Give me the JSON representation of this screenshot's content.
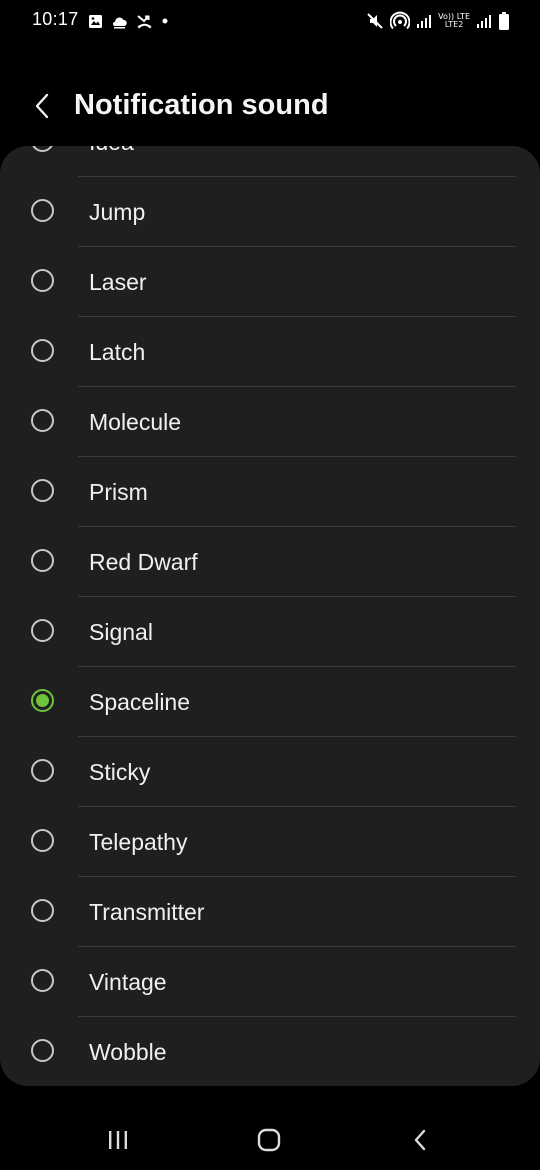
{
  "status_bar": {
    "time": "10:17",
    "network_top": "Vo)) LTE",
    "network_bottom": "LTE2"
  },
  "header": {
    "title": "Notification sound"
  },
  "sounds": [
    {
      "label": "Idea",
      "selected": false
    },
    {
      "label": "Jump",
      "selected": false
    },
    {
      "label": "Laser",
      "selected": false
    },
    {
      "label": "Latch",
      "selected": false
    },
    {
      "label": "Molecule",
      "selected": false
    },
    {
      "label": "Prism",
      "selected": false
    },
    {
      "label": "Red Dwarf",
      "selected": false
    },
    {
      "label": "Signal",
      "selected": false
    },
    {
      "label": "Spaceline",
      "selected": true
    },
    {
      "label": "Sticky",
      "selected": false
    },
    {
      "label": "Telepathy",
      "selected": false
    },
    {
      "label": "Transmitter",
      "selected": false
    },
    {
      "label": "Vintage",
      "selected": false
    },
    {
      "label": "Wobble",
      "selected": false
    }
  ],
  "colors": {
    "accent": "#6fc23b",
    "card_background": "#1f1f1f",
    "page_background": "#000000"
  },
  "icons": {
    "status_left": [
      "image-icon",
      "weather-icon",
      "missed-call-icon",
      "dot-icon"
    ],
    "status_right": [
      "mute-icon",
      "hotspot-icon",
      "signal-icon",
      "signal-icon",
      "battery-icon"
    ],
    "nav": [
      "recents-icon",
      "home-icon",
      "back-icon"
    ]
  }
}
